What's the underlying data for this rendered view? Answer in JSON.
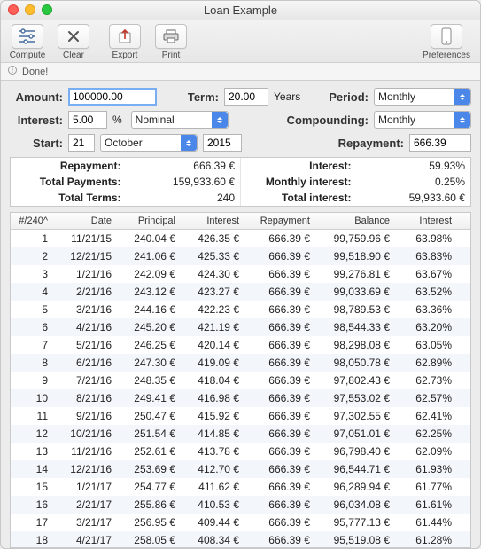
{
  "window": {
    "title": "Loan Example"
  },
  "toolbar": {
    "compute": "Compute",
    "clear": "Clear",
    "export": "Export",
    "print": "Print",
    "preferences": "Preferences"
  },
  "status": {
    "text": "Done!"
  },
  "form": {
    "amount_label": "Amount:",
    "amount_value": "100000.00",
    "term_label": "Term:",
    "term_value": "20.00",
    "term_unit": "Years",
    "period_label": "Period:",
    "period_value": "Monthly",
    "interest_label": "Interest:",
    "interest_value": "5.00",
    "interest_unit": "%",
    "rate_type_value": "Nominal",
    "compounding_label": "Compounding:",
    "compounding_value": "Monthly",
    "start_label": "Start:",
    "start_day": "21",
    "start_month": "October",
    "start_year": "2015",
    "repayment_label": "Repayment:",
    "repayment_value": "666.39"
  },
  "summary": {
    "rows": [
      {
        "k1": "Repayment:",
        "v1": "666.39 €",
        "k2": "Interest:",
        "v2": "59.93%"
      },
      {
        "k1": "Total Payments:",
        "v1": "159,933.60 €",
        "k2": "Monthly interest:",
        "v2": "0.25%"
      },
      {
        "k1": "Total Terms:",
        "v1": "240",
        "k2": "Total interest:",
        "v2": "59,933.60 €"
      }
    ]
  },
  "table": {
    "headers": [
      "#/240^",
      "Date",
      "Principal",
      "Interest",
      "Repayment",
      "Balance",
      "Interest"
    ],
    "rows": [
      [
        "1",
        "11/21/15",
        "240.04 €",
        "426.35 €",
        "666.39 €",
        "99,759.96 €",
        "63.98%"
      ],
      [
        "2",
        "12/21/15",
        "241.06 €",
        "425.33 €",
        "666.39 €",
        "99,518.90 €",
        "63.83%"
      ],
      [
        "3",
        "1/21/16",
        "242.09 €",
        "424.30 €",
        "666.39 €",
        "99,276.81 €",
        "63.67%"
      ],
      [
        "4",
        "2/21/16",
        "243.12 €",
        "423.27 €",
        "666.39 €",
        "99,033.69 €",
        "63.52%"
      ],
      [
        "5",
        "3/21/16",
        "244.16 €",
        "422.23 €",
        "666.39 €",
        "98,789.53 €",
        "63.36%"
      ],
      [
        "6",
        "4/21/16",
        "245.20 €",
        "421.19 €",
        "666.39 €",
        "98,544.33 €",
        "63.20%"
      ],
      [
        "7",
        "5/21/16",
        "246.25 €",
        "420.14 €",
        "666.39 €",
        "98,298.08 €",
        "63.05%"
      ],
      [
        "8",
        "6/21/16",
        "247.30 €",
        "419.09 €",
        "666.39 €",
        "98,050.78 €",
        "62.89%"
      ],
      [
        "9",
        "7/21/16",
        "248.35 €",
        "418.04 €",
        "666.39 €",
        "97,802.43 €",
        "62.73%"
      ],
      [
        "10",
        "8/21/16",
        "249.41 €",
        "416.98 €",
        "666.39 €",
        "97,553.02 €",
        "62.57%"
      ],
      [
        "11",
        "9/21/16",
        "250.47 €",
        "415.92 €",
        "666.39 €",
        "97,302.55 €",
        "62.41%"
      ],
      [
        "12",
        "10/21/16",
        "251.54 €",
        "414.85 €",
        "666.39 €",
        "97,051.01 €",
        "62.25%"
      ],
      [
        "13",
        "11/21/16",
        "252.61 €",
        "413.78 €",
        "666.39 €",
        "96,798.40 €",
        "62.09%"
      ],
      [
        "14",
        "12/21/16",
        "253.69 €",
        "412.70 €",
        "666.39 €",
        "96,544.71 €",
        "61.93%"
      ],
      [
        "15",
        "1/21/17",
        "254.77 €",
        "411.62 €",
        "666.39 €",
        "96,289.94 €",
        "61.77%"
      ],
      [
        "16",
        "2/21/17",
        "255.86 €",
        "410.53 €",
        "666.39 €",
        "96,034.08 €",
        "61.61%"
      ],
      [
        "17",
        "3/21/17",
        "256.95 €",
        "409.44 €",
        "666.39 €",
        "95,777.13 €",
        "61.44%"
      ],
      [
        "18",
        "4/21/17",
        "258.05 €",
        "408.34 €",
        "666.39 €",
        "95,519.08 €",
        "61.28%"
      ]
    ]
  }
}
